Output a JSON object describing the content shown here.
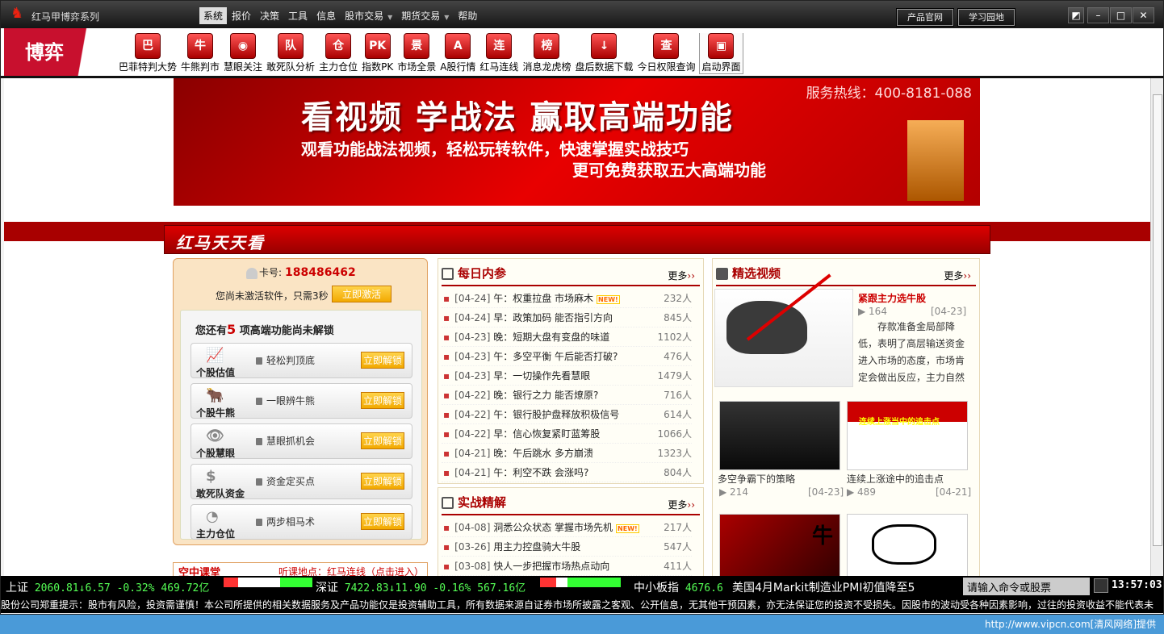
{
  "window": {
    "title": "红马甲博弈系列",
    "menu": [
      {
        "label": "系统",
        "active": true
      },
      {
        "label": "报价"
      },
      {
        "label": "决策"
      },
      {
        "label": "工具"
      },
      {
        "label": "信息"
      },
      {
        "label": "股市交易",
        "drop": true
      },
      {
        "label": "期货交易",
        "drop": true
      },
      {
        "label": "帮助"
      }
    ],
    "btn_product": "产品官网",
    "btn_study": "学习园地"
  },
  "toolbar": {
    "brand": "博弈",
    "items": [
      {
        "label": "巴菲特判大势",
        "icon": "巴"
      },
      {
        "label": "牛熊判市",
        "icon": "牛"
      },
      {
        "label": "慧眼关注",
        "icon": "◉"
      },
      {
        "label": "敢死队分析",
        "icon": "队"
      },
      {
        "label": "主力仓位",
        "icon": "仓"
      },
      {
        "label": "指数PK",
        "icon": "PK"
      },
      {
        "label": "市场全景",
        "icon": "景"
      },
      {
        "label": "A股行情",
        "icon": "A"
      },
      {
        "label": "红马连线",
        "icon": "连"
      },
      {
        "label": "消息龙虎榜",
        "icon": "榜"
      },
      {
        "label": "盘后数据下载",
        "icon": "↓"
      },
      {
        "label": "今日权限查询",
        "icon": "查"
      },
      {
        "label": "启动界面",
        "icon": "▣"
      }
    ]
  },
  "banner": {
    "line1": "看视频 学战法 赢取高端功能",
    "line2": "观看功能战法视频，轻松玩转软件，快速掌握实战技巧",
    "line3": "更可免费获取五大高端功能",
    "hotline": "服务热线：400-8181-088"
  },
  "section": {
    "title": "红马天天看"
  },
  "account": {
    "card_label": "卡号:",
    "card_no": "188486462",
    "note": "您尚未激活软件，只需3秒",
    "activate": "立即激活",
    "locked_pre": "您还有",
    "locked_count": "5",
    "locked_post": "项高端功能尚未解锁",
    "unlock": "立即解锁",
    "features": [
      {
        "name": "个股估值",
        "desc": "轻松判顶底",
        "icon": "📈"
      },
      {
        "name": "个股牛熊",
        "desc": "一眼辨牛熊",
        "icon": "🐂"
      },
      {
        "name": "个股慧眼",
        "desc": "慧眼抓机会",
        "icon": "👁"
      },
      {
        "name": "敢死队资金",
        "desc": "资金定买点",
        "icon": "$"
      },
      {
        "name": "主力仓位",
        "desc": "两步相马术",
        "icon": "◔"
      }
    ]
  },
  "course": {
    "title": "空中课堂",
    "place": "听课地点：红马连线（点击进入）"
  },
  "daily": {
    "title": "每日内参",
    "more": "更多",
    "items": [
      {
        "date": "[04-24]",
        "text": "午：权重拉盘 市场麻木",
        "count": "232人",
        "new": true
      },
      {
        "date": "[04-24]",
        "text": "早：政策加码 能否指引方向",
        "count": "845人"
      },
      {
        "date": "[04-23]",
        "text": "晚：短期大盘有变盘的味道",
        "count": "1102人"
      },
      {
        "date": "[04-23]",
        "text": "午：多空平衡 午后能否打破?",
        "count": "476人"
      },
      {
        "date": "[04-23]",
        "text": "早：一切操作先看慧眼",
        "count": "1479人"
      },
      {
        "date": "[04-22]",
        "text": "晚：银行之力 能否燎原?",
        "count": "716人"
      },
      {
        "date": "[04-22]",
        "text": "午：银行股护盘释放积极信号",
        "count": "614人"
      },
      {
        "date": "[04-22]",
        "text": "早：信心恢复紧盯蓝筹股",
        "count": "1066人"
      },
      {
        "date": "[04-21]",
        "text": "晚：午后跳水 多方崩溃",
        "count": "1323人"
      },
      {
        "date": "[04-21]",
        "text": "午：利空不跌 会涨吗?",
        "count": "804人"
      }
    ]
  },
  "tactics": {
    "title": "实战精解",
    "more": "更多",
    "items": [
      {
        "date": "[04-08]",
        "text": "洞悉公众状态 掌握市场先机",
        "count": "217人",
        "new": true
      },
      {
        "date": "[03-26]",
        "text": "用主力控盘骑大牛股",
        "count": "547人"
      },
      {
        "date": "[03-08]",
        "text": "快人一步把握市场热点动向",
        "count": "411人"
      }
    ]
  },
  "videos": {
    "title": "精选视频",
    "more": "更多",
    "featured": {
      "title": "紧跟主力选牛股",
      "views": "164",
      "date": "[04-23]",
      "desc": "存款准备金局部降低，表明了高层输送资金进入市场的态度，市场肯定会做出反应，主力自然"
    },
    "items": [
      {
        "caption": "多空争霸下的策略",
        "views": "214",
        "date": "[04-23]",
        "thumb_text": ""
      },
      {
        "caption": "连续上涨途中的追击点",
        "views": "489",
        "date": "[04-21]",
        "thumb_text": "连续上涨当中的追击点"
      }
    ],
    "row3": [
      {
        "thumb_text": "牛"
      },
      {
        "thumb_text": ""
      }
    ]
  },
  "status": {
    "sh_name": "上证",
    "sh": "2060.81",
    "sh_chg": "6.57",
    "sh_pct": "-0.32%",
    "sh_amt": "469.72亿",
    "sz_name": "深证",
    "sz": "7422.83",
    "sz_chg": "11.90",
    "sz_pct": "-0.16%",
    "sz_amt": "567.16亿",
    "zx_name": "中小板指",
    "zx": "4676.6",
    "ticker": "美国4月Markit制造业PMI初值降至5",
    "cmd": "请输入命令或股票",
    "clock": "13:57:03"
  },
  "notice": "股份公司郑重提示：股市有风险，投资需谨慎！本公司所提供的相关数据服务及产品功能仅是投资辅助工具，所有数据来源自证券市场所披露之客观、公开信息，无其他干预因素，亦无法保证您的投资不受损失。因股市的波动受各种因素影响，过往的投资收益不能代表未",
  "footer": "http://www.vipcn.com[清风网络]提供",
  "colors": {
    "accent": "#c8102e",
    "up": "#ff3333",
    "down": "#33ff33"
  }
}
